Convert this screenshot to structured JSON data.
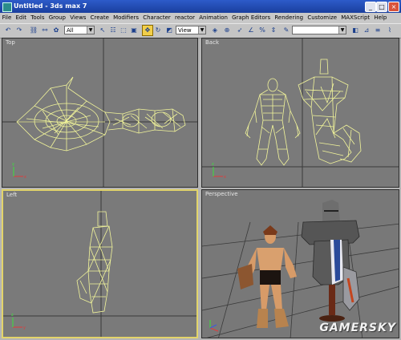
{
  "window": {
    "title": "Untitled - 3ds max 7"
  },
  "menu": [
    "File",
    "Edit",
    "Tools",
    "Group",
    "Views",
    "Create",
    "Modifiers",
    "Character",
    "reactor",
    "Animation",
    "Graph Editors",
    "Rendering",
    "Customize",
    "MAXScript",
    "Help"
  ],
  "toolbar": {
    "selection_filter": "All",
    "reference_coord": "View"
  },
  "viewports": {
    "top": "Top",
    "back": "Back",
    "left": "Left",
    "perspective": "Perspective"
  },
  "watermark": "GAMERSKY",
  "colors": {
    "wireframe": "#f2f59a",
    "viewport_bg": "#7a7a7a",
    "active_border": "#e2d46a"
  }
}
